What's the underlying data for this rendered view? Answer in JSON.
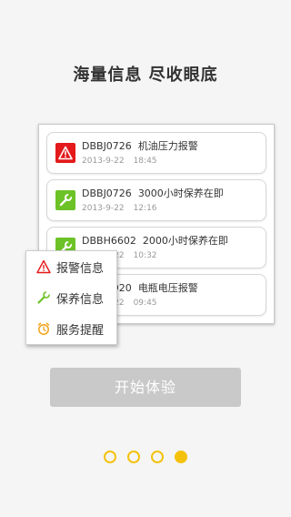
{
  "headline": "海量信息 尽收眼底",
  "cards": [
    {
      "icon": "warning-icon",
      "type": "alarm",
      "code": "DBBJ0726",
      "message": "机油压力报警",
      "date": "2013-9-22",
      "time": "18:45"
    },
    {
      "icon": "wrench-icon",
      "type": "maint",
      "code": "DBBJ0726",
      "message": "3000小时保养在即",
      "date": "2013-9-22",
      "time": "12:16"
    },
    {
      "icon": "wrench-icon",
      "type": "maint",
      "code": "DBBH6602",
      "message": "2000小时保养在即",
      "date": "2013-9-22",
      "time": "10:32"
    },
    {
      "icon": "alarm-icon",
      "type": "alarm",
      "code": "DBBJ0920",
      "message": "电瓶电压报警",
      "date": "2013-9-22",
      "time": "09:45"
    }
  ],
  "menu": {
    "items": [
      {
        "label": "报警信息",
        "icon": "warning-triangle-icon"
      },
      {
        "label": "保养信息",
        "icon": "wrench-outline-icon"
      },
      {
        "label": "服务提醒",
        "icon": "alarm-clock-icon"
      }
    ]
  },
  "start_button": {
    "label": "开始体验"
  },
  "pager": {
    "count": 4,
    "active_index": 3
  },
  "colors": {
    "accent": "#f4c20d",
    "alarm_red": "#e4191b",
    "maint_green": "#6cc227",
    "button_gray": "#c9c9c9",
    "background": "#f5f5f5"
  }
}
